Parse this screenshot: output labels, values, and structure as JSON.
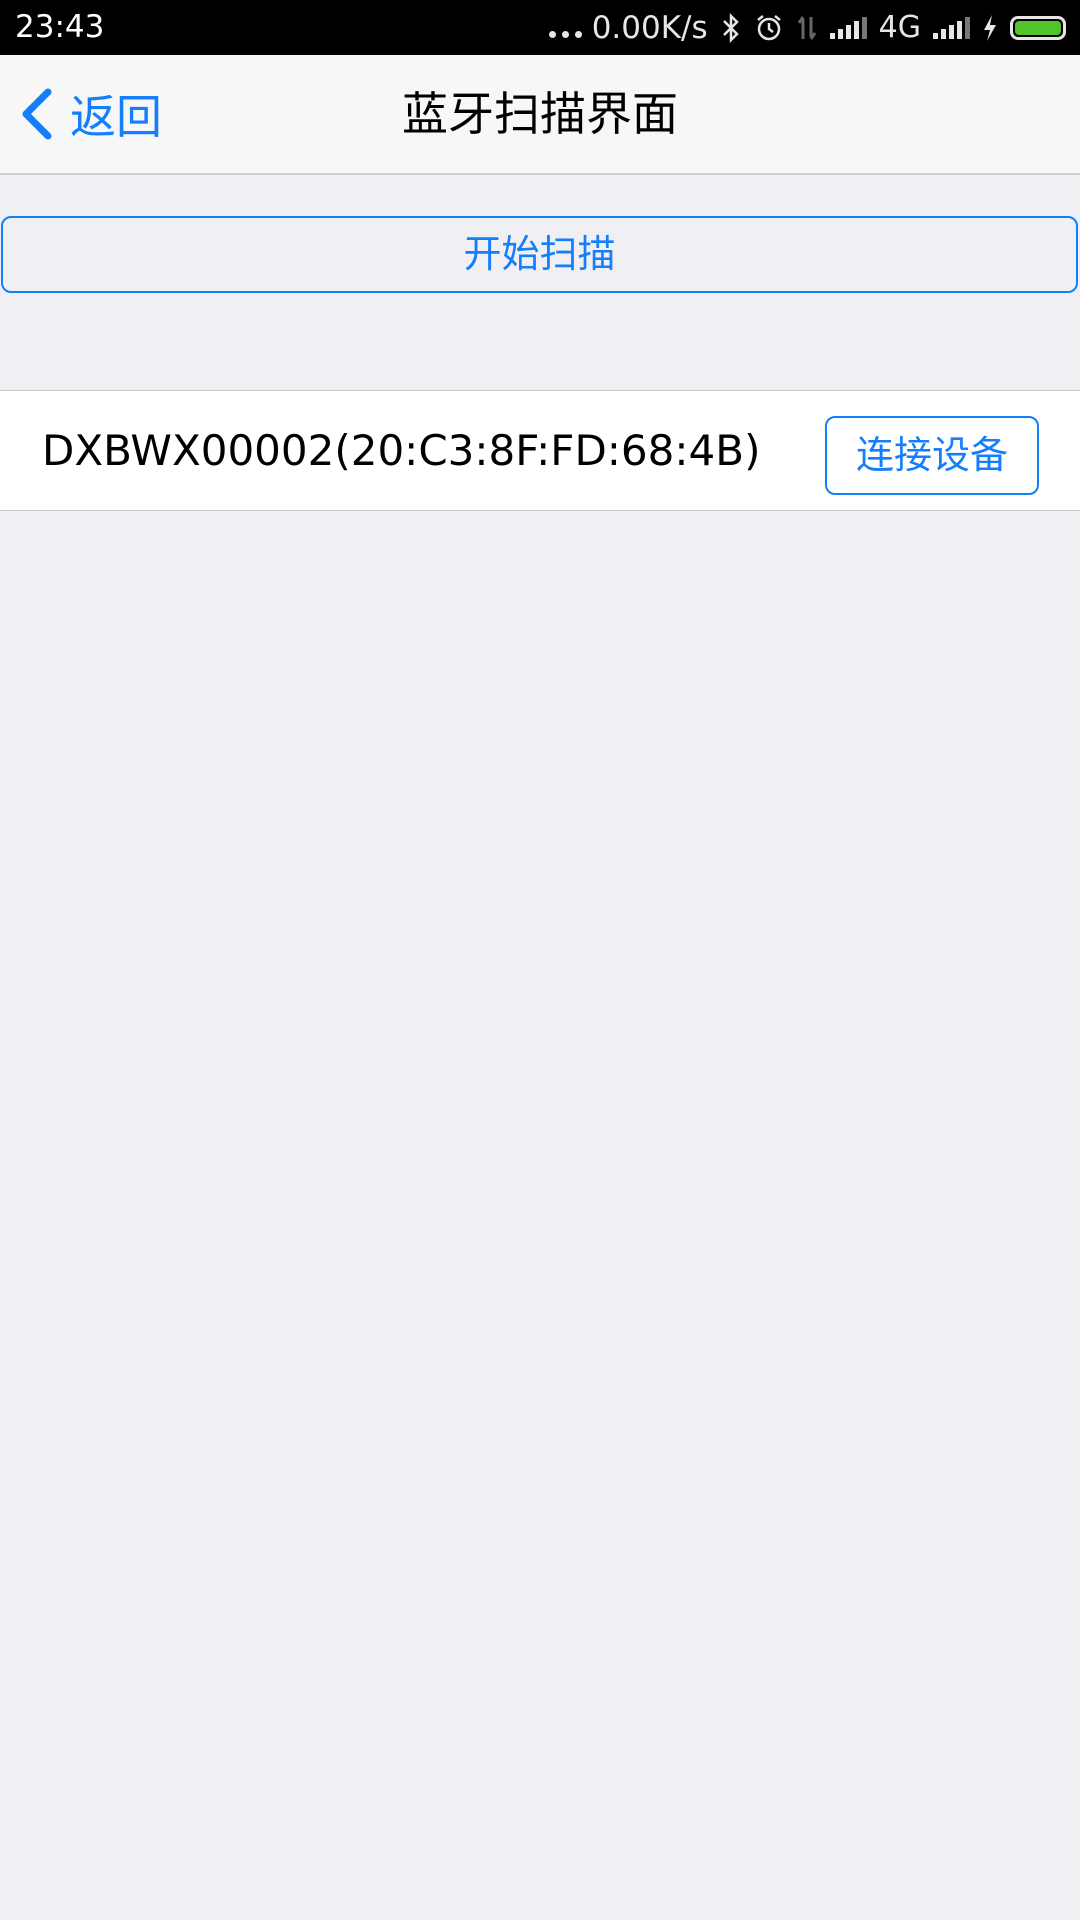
{
  "status_bar": {
    "time": "23:43",
    "net_speed": "0.00K/s",
    "network_type": "4G",
    "icons": [
      "more-dots-icon",
      "bluetooth-icon",
      "alarm-icon",
      "data-arrows-icon",
      "signal-icon",
      "signal-icon-2",
      "charging-icon",
      "battery-icon"
    ],
    "battery_color": "#4fc52a"
  },
  "nav": {
    "back_label": "返回",
    "title": "蓝牙扫描界面",
    "accent_color": "#157efb"
  },
  "scan": {
    "button_label": "开始扫描"
  },
  "devices": [
    {
      "name": "DXBWX00002(20:C3:8F:FD:68:4B)",
      "connect_label": "连接设备"
    }
  ]
}
